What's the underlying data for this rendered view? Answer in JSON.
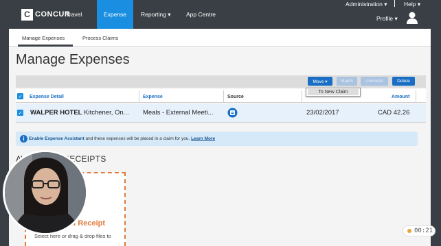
{
  "header": {
    "logo_letter": "C",
    "logo_text": "CONCUR",
    "nav": [
      "Travel",
      "Expense",
      "Reporting ▾",
      "App Centre"
    ],
    "administration": "Administration ▾",
    "help": "Help ▾",
    "profile": "Profile ▾"
  },
  "subnav": {
    "manage": "Manage Expenses",
    "process": "Process Claims"
  },
  "page_title": "Manage Expenses",
  "toolbar": {
    "move": "Move ▾",
    "match": "Match",
    "unmatch": "Unmatch",
    "delete": "Delete"
  },
  "move_menu": {
    "item": "To New Claim"
  },
  "table": {
    "headers": {
      "detail": "Expense Detail",
      "expense": "Expense",
      "source": "Source",
      "amount": "Amount"
    },
    "rows": [
      {
        "merchant": "WALPER HOTEL",
        "location": " Kitchener, On...",
        "expense_type": "Meals - External Meeti...",
        "date": "23/02/2017",
        "amount": "CAD 42.26"
      }
    ]
  },
  "banner": {
    "strong": "Enable Expense Assistant",
    "text": " and these expenses will be placed in a claim for you. ",
    "link": "Learn More"
  },
  "receipts": {
    "heading": "AVAILABLE RECEIPTS",
    "upload_title": "Upload Receipt",
    "upload_sub": "Select here or drag & drop files to"
  },
  "timer": "00:21",
  "colors": {
    "accent": "#1a8ee0",
    "primary_button": "#1a6fc4",
    "header": "#3a3f45",
    "dropzone": "#e07a3a"
  }
}
